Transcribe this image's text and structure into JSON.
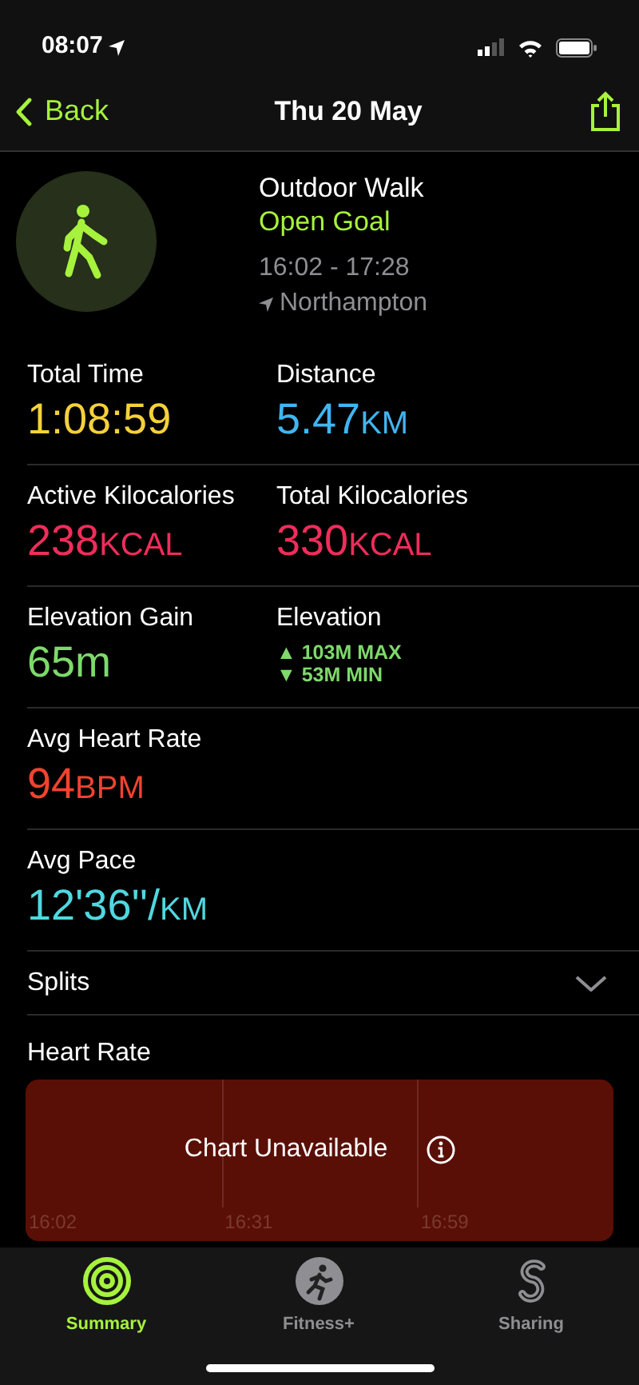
{
  "status_bar": {
    "time": "08:07"
  },
  "nav": {
    "back": "Back",
    "title": "Thu 20 May"
  },
  "workout": {
    "name": "Outdoor Walk",
    "goal": "Open Goal",
    "time_range": "16:02 - 17:28",
    "location": "Northampton"
  },
  "metric_rows": [
    [
      {
        "kind": "value",
        "label": "Total Time",
        "value": "1:08:59",
        "color": "#f5d13a"
      },
      {
        "kind": "value",
        "label": "Distance",
        "value": "5.47",
        "unit": "KM",
        "color": "#3fb6f2"
      }
    ],
    [
      {
        "kind": "value",
        "label": "Active Kilocalories",
        "value": "238",
        "unit": "KCAL",
        "color": "#ef2d5a"
      },
      {
        "kind": "value",
        "label": "Total Kilocalories",
        "value": "330",
        "unit": "KCAL",
        "color": "#ef2d5a"
      }
    ],
    [
      {
        "kind": "value",
        "label": "Elevation Gain",
        "value": "65m",
        "color": "#7ed96b"
      },
      {
        "kind": "range",
        "label": "Elevation",
        "max": "▲ 103M MAX",
        "min": "▼ 53M MIN",
        "color": "#7ed96b"
      }
    ],
    [
      {
        "kind": "value",
        "label": "Avg Heart Rate",
        "value": "94",
        "unit": "BPM",
        "color": "#f1432f"
      }
    ],
    [
      {
        "kind": "value",
        "label": "Avg Pace",
        "value": "12'36''/",
        "unit": "KM",
        "color": "#4fd8e0"
      }
    ]
  ],
  "splits": {
    "label": "Splits",
    "expanded": false
  },
  "heart_rate": {
    "label": "Heart Rate",
    "message": "Chart Unavailable",
    "time_labels": [
      "16:02",
      "16:31",
      "16:59"
    ]
  },
  "tabs": [
    {
      "label": "Summary",
      "selected": true
    },
    {
      "label": "Fitness+",
      "selected": false
    },
    {
      "label": "Sharing",
      "selected": false
    }
  ]
}
